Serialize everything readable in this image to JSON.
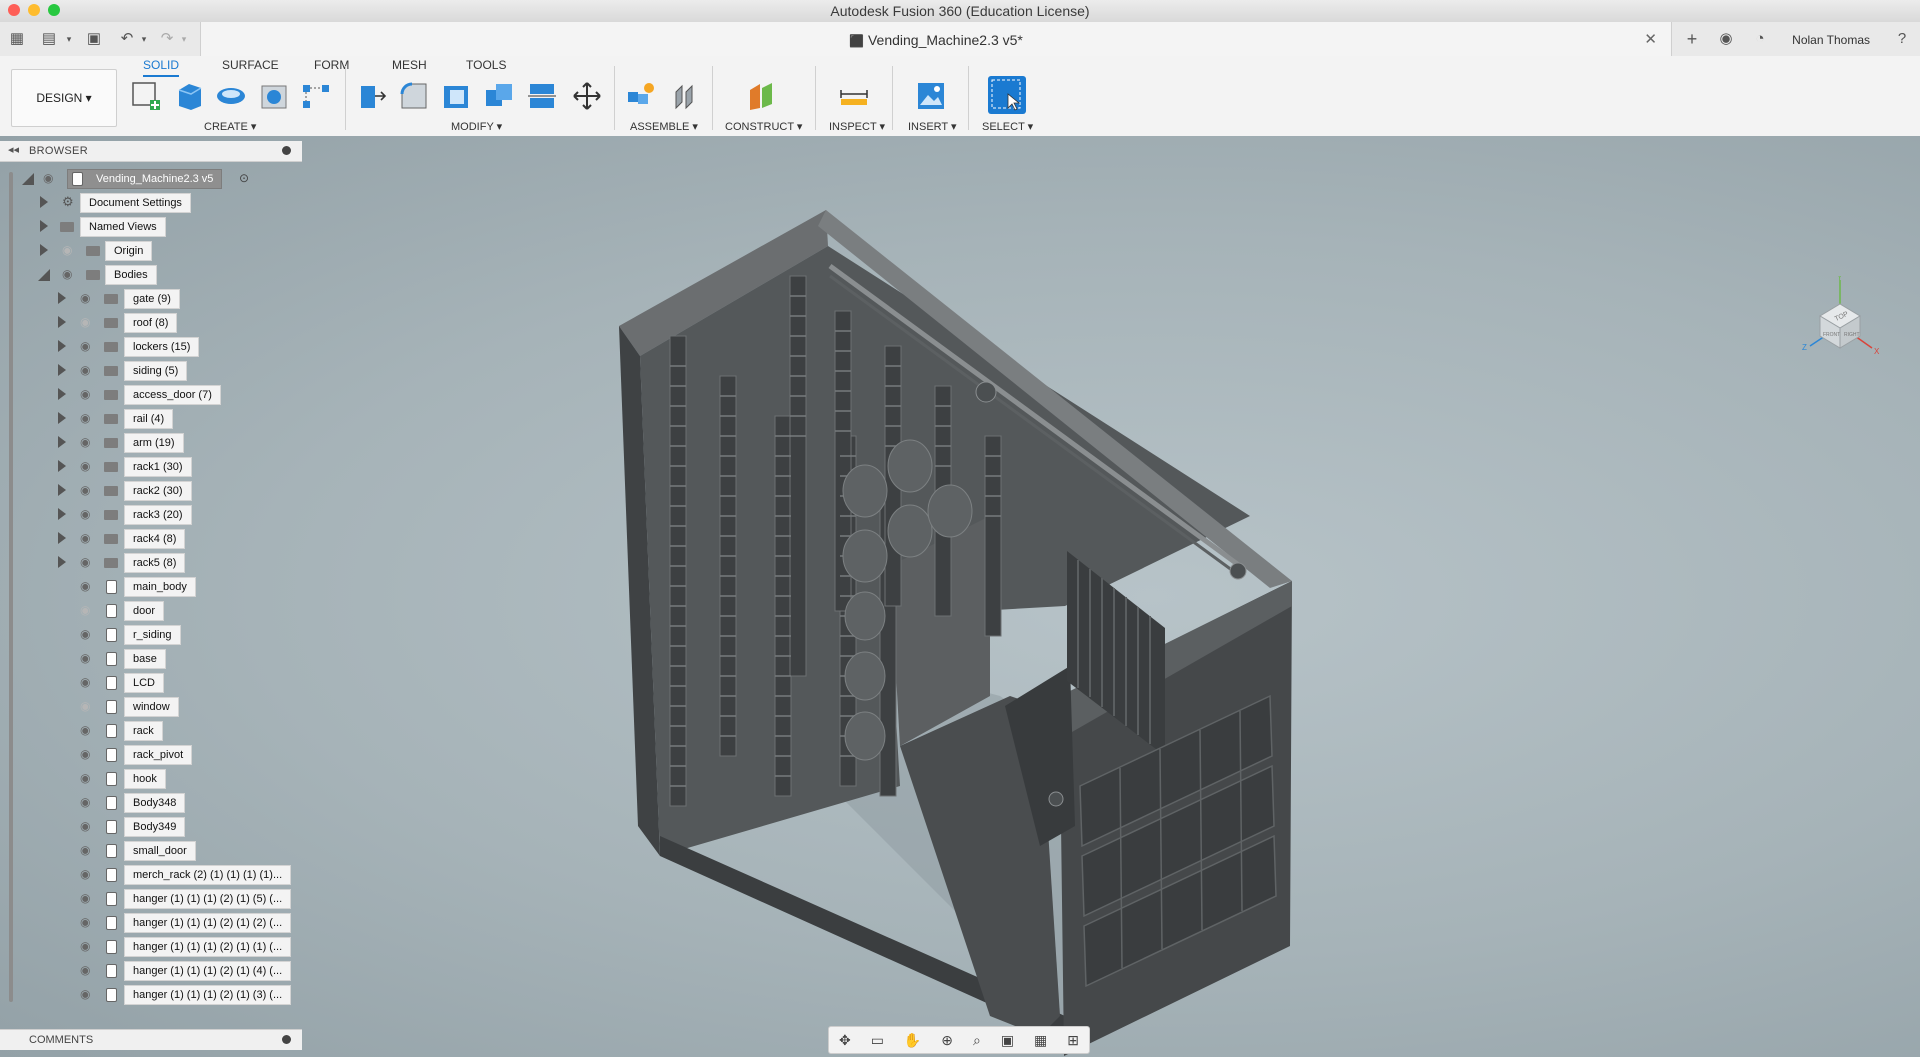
{
  "window": {
    "title": "Autodesk Fusion 360 (Education License)"
  },
  "tabbar": {
    "doc_name": "Vending_Machine2.3 v5*",
    "user": "Nolan Thomas"
  },
  "ribbon": {
    "tabs": [
      "SOLID",
      "SURFACE",
      "FORM",
      "MESH",
      "TOOLS"
    ],
    "active_tab": "SOLID",
    "workspace": "DESIGN ▾",
    "groups": [
      "CREATE ▾",
      "MODIFY ▾",
      "ASSEMBLE ▾",
      "CONSTRUCT ▾",
      "INSPECT ▾",
      "INSERT ▾",
      "SELECT ▾"
    ]
  },
  "browser": {
    "title": "BROWSER",
    "root": "Vending_Machine2.3 v5",
    "top_items": [
      "Document Settings",
      "Named Views",
      "Origin",
      "Bodies"
    ],
    "body_folders": [
      "gate (9)",
      "roof (8)",
      "lockers (15)",
      "siding (5)",
      "access_door (7)",
      "rail (4)",
      "arm (19)",
      "rack1 (30)",
      "rack2 (30)",
      "rack3 (20)",
      "rack4 (8)",
      "rack5 (8)"
    ],
    "bodies": [
      "main_body",
      "door",
      "r_siding",
      "base",
      "LCD",
      "window",
      "rack",
      "rack_pivot",
      "hook",
      "Body348",
      "Body349",
      "small_door",
      "merch_rack (2) (1) (1) (1) (1)...",
      "hanger (1) (1) (1) (2) (1) (5) (...",
      "hanger (1) (1) (1) (2) (1) (2) (...",
      "hanger (1) (1) (1) (2) (1) (1) (...",
      "hanger (1) (1) (1) (2) (1) (4) (...",
      "hanger (1) (1) (1) (2) (1) (3) (..."
    ],
    "hidden_bodies": [
      "door",
      "window"
    ],
    "hidden_folders": [
      "roof (8)"
    ]
  },
  "comments": {
    "title": "COMMENTS"
  },
  "viewcube": {
    "top": "TOP",
    "front": "FRONT",
    "right": "RIGHT",
    "x": "X",
    "y": "Y",
    "z": "Z"
  },
  "colors": {
    "accent": "#1a7ad1",
    "model": "#4a4d50",
    "viewport": "#a6b3b8"
  }
}
